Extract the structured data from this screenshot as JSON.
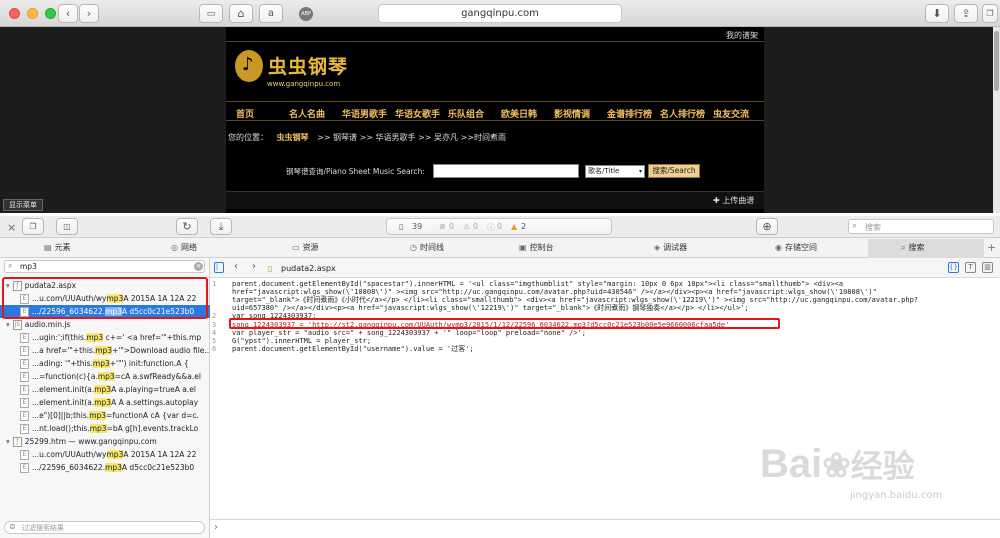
{
  "browser": {
    "url": "gangqinpu.com"
  },
  "site": {
    "my_scores": "我的谱架",
    "logo_title": "虫虫钢琴",
    "logo_url": "www.gangqinpu.com",
    "nav": [
      "首页",
      "名人名曲",
      "华语男歌手",
      "华语女歌手",
      "乐队组合",
      "欧美日韩",
      "影视情调",
      "金谱排行榜",
      "名人排行榜",
      "虫友交流"
    ],
    "breadcrumb": {
      "prefix": "您的位置：",
      "home": "虫虫钢琴",
      "rest": ">> 钢琴谱 >> 华语男歌手 >> 吴亦凡 >>时间煮雨"
    },
    "search_label": "钢琴谱查询/Piano Sheet Music Search:",
    "search_option": "歌名/Title",
    "search_button": "搜索/Search",
    "upload": "上传曲谱",
    "show_menu": "显示菜单"
  },
  "devtools": {
    "counts": {
      "resources": "39",
      "errors": "0",
      "warnings": "0",
      "logs": "2"
    },
    "search_placeholder": "搜索",
    "tabs": [
      "元素",
      "网络",
      "资源",
      "时间线",
      "控制台",
      "调试器",
      "存储空间",
      "搜索"
    ],
    "sidebar_query": "mp3",
    "sidebar_filter_placeholder": "过滤搜索结果",
    "results": [
      {
        "file": "pudata2.aspx",
        "items": [
          {
            "pre": "...u.com/UUAuth/wy",
            "hit": "mp3",
            "post": "A  2015A  1A  12A  22"
          },
          {
            "pre": ".../22596_6034622.",
            "hit": "mp3",
            "post": "A  d5cc0c21e523b0"
          }
        ]
      },
      {
        "file": "audio.min.js",
        "items": [
          {
            "pre": "...ugin:';if(this.",
            "hit": "mp3",
            "post": " c+=' <a href='\"+this.mp"
          },
          {
            "pre": "...a href='\"+this.",
            "hit": "mp3",
            "post": "+'\">Download audio file..."
          },
          {
            "pre": "...ading: '\"+this.",
            "hit": "mp3",
            "post": "+'\"') init:function.A {"
          },
          {
            "pre": "...=function(c){a.",
            "hit": "mp3",
            "post": "=cA a.swfReady&&a.el"
          },
          {
            "pre": "...element.init(a.",
            "hit": "mp3",
            "post": "A a.playing=trueA a.el"
          },
          {
            "pre": "...element.init(a.",
            "hit": "mp3",
            "post": "A A a.settings.autoplay"
          },
          {
            "pre": "...e\")[0]||b;this.",
            "hit": "mp3",
            "post": "=functionA cA {var d=c."
          },
          {
            "pre": "...nt.load();this.",
            "hit": "mp3",
            "post": "=bA g[h].events.trackLo"
          }
        ]
      },
      {
        "file": "25299.htm — www.gangqinpu.com",
        "items": [
          {
            "pre": "...u.com/UUAuth/wy",
            "hit": "mp3",
            "post": "A  2015A  1A  12A  22"
          },
          {
            "pre": ".../22596_6034622.",
            "hit": "mp3",
            "post": "A  d5cc0c21e523b0"
          }
        ]
      }
    ],
    "editor": {
      "file": "pudata2.aspx",
      "lines": [
        "parent.document.getElementById(\"spacestar\").innerHTML = '<ul class=\"imgthumblist\" style=\"margin: 10px 0 6px 10px\"><li class=\"smallthumb\"> <div><a",
        "href=\"javascript:wlgs_show(\\'10808\\')\" ><img src=\"http://uc.gangqinpu.com/avatar.php?uid=430546\"  /></a></div><p><a href=\"javascript:wlgs_show(\\'10808\\')\"",
        "target=\"_blank\">《时间煮雨》《小时代</a></p> </li><li class=\"smallthumb\"> <div><a href=\"javascript:wlgs_show(\\'12219\\')\" ><img src=\"http://uc.gangqinpu.com/avatar.php?",
        "uid=657380\"   /></a></div><p><a href=\"javascript:wlgs_show(\\'12219\\')\" target=\"_blank\">《时间煮雨》钢琴独奏</a></p> </li></ul>';",
        "var song_1224303937;",
        "song_1224303937 = 'http://st2.gangqinpu.com/UUAuth/wymp3/2015/1/12/22596_6034622.mp3?d5cc0c21e523b00e5e9660006cfaa5de'",
        "var player_str = \"audio src=\" + song_1224303937 + '\"  loop=\"loop\" preload=\"none\"  />';",
        "G(\"ypst\").innerHTML = player_str;",
        "parent.document.getElementById(\"username\").value = '过客';"
      ],
      "line_numbers": [
        "1",
        "",
        "",
        "",
        "2",
        "3",
        "4",
        "5",
        "6"
      ]
    }
  },
  "watermark": {
    "text": "Bai",
    "text2": "经验",
    "url": "jingyan.baidu.com"
  }
}
